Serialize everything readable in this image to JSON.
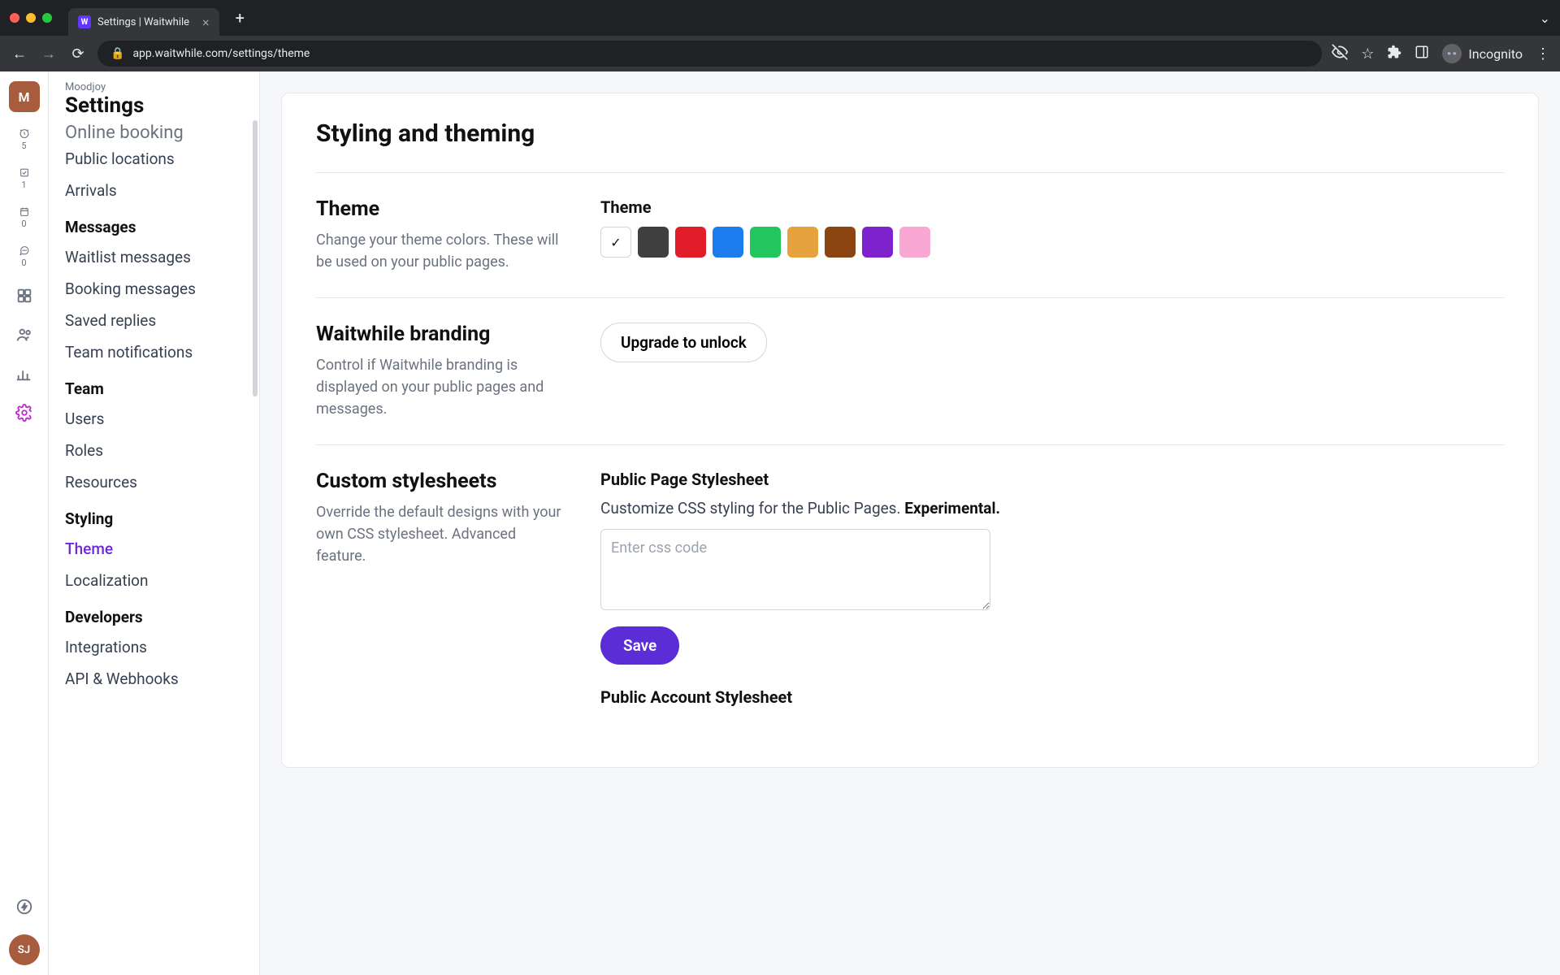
{
  "browser": {
    "tab_title": "Settings | Waitwhile",
    "tab_favicon_letter": "W",
    "url": "app.waitwhile.com/settings/theme",
    "incognito_label": "Incognito"
  },
  "rail": {
    "avatar_letter": "M",
    "badges": {
      "clock": "5",
      "checkbox": "1",
      "calendar": "0",
      "chat": "0"
    },
    "bottom_avatar": "SJ"
  },
  "header": {
    "breadcrumb": "Moodjoy",
    "title": "Settings"
  },
  "sidebar": {
    "cut_item": "Online booking",
    "items_top": [
      "Public locations",
      "Arrivals"
    ],
    "sections": [
      {
        "title": "Messages",
        "items": [
          "Waitlist messages",
          "Booking messages",
          "Saved replies",
          "Team notifications"
        ]
      },
      {
        "title": "Team",
        "items": [
          "Users",
          "Roles",
          "Resources"
        ]
      },
      {
        "title": "Styling",
        "items": [
          "Theme",
          "Localization"
        ],
        "active": "Theme"
      },
      {
        "title": "Developers",
        "items": [
          "Integrations",
          "API & Webhooks"
        ]
      }
    ]
  },
  "main": {
    "card_title": "Styling and theming",
    "theme": {
      "heading": "Theme",
      "desc": "Change your theme colors. These will be used on your public pages.",
      "field_label": "Theme",
      "colors": [
        "#ffffff",
        "#3f3f3f",
        "#e11d2a",
        "#1d7ced",
        "#22c55e",
        "#e6a23c",
        "#8b4513",
        "#7e22ce",
        "#f9a8d4"
      ]
    },
    "branding": {
      "heading": "Waitwhile branding",
      "desc": "Control if Waitwhile branding is displayed on your public pages and messages.",
      "button": "Upgrade to unlock"
    },
    "css": {
      "heading": "Custom stylesheets",
      "desc": "Override the default designs with your own CSS stylesheet. Advanced feature.",
      "public_label": "Public Page Stylesheet",
      "public_desc": "Customize CSS styling for the Public Pages. ",
      "public_desc_bold": "Experimental.",
      "placeholder": "Enter css code",
      "save": "Save",
      "account_label": "Public Account Stylesheet"
    }
  }
}
